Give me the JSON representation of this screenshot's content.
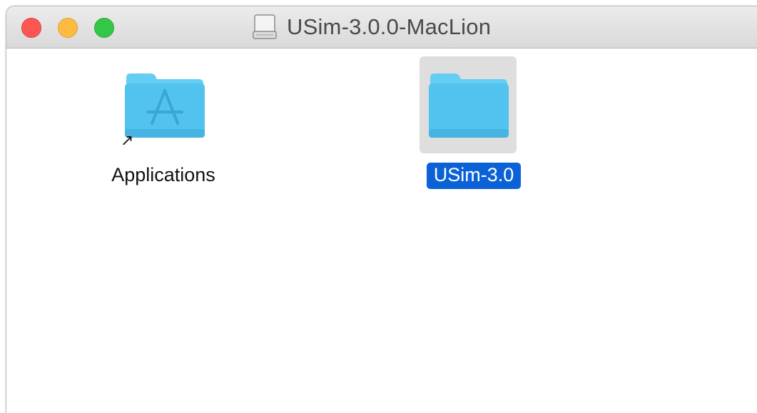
{
  "window": {
    "title": "USim-3.0.0-MacLion",
    "title_icon": "disk-image-icon",
    "traffic_lights": {
      "close_color": "#fc5753",
      "minimize_color": "#fdbc40",
      "maximize_color": "#33c748"
    }
  },
  "items": [
    {
      "label": "Applications",
      "icon": "applications-folder-icon",
      "alias": true,
      "selected": false
    },
    {
      "label": "USim-3.0",
      "icon": "folder-icon",
      "alias": false,
      "selected": true
    }
  ],
  "colors": {
    "folder": "#4fc6ef",
    "selection_label_bg": "#0b62d6",
    "selection_icon_bg": "#dedede"
  }
}
